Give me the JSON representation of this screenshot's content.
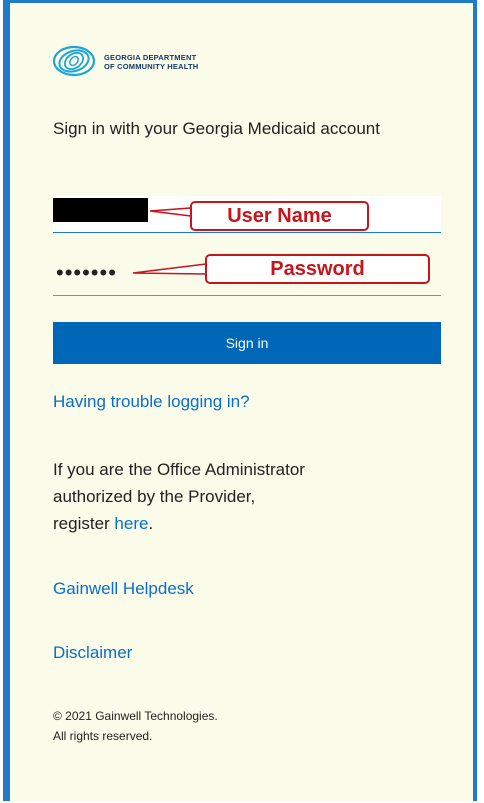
{
  "logo": {
    "line1": "Georgia Department",
    "line2": "of Community Health"
  },
  "heading": "Sign in with your Georgia Medicaid account",
  "username": {
    "value": "",
    "callout": "User Name"
  },
  "password": {
    "masked_value": "•••••••",
    "callout": "Password"
  },
  "sign_in_label": "Sign in",
  "trouble_link": "Having trouble logging in?",
  "admin_text": {
    "line1": "If you are the Office Administrator",
    "line2": "authorized by the Provider,",
    "prefix": "register ",
    "link": "here",
    "suffix": "."
  },
  "helpdesk_link": "Gainwell Helpdesk",
  "disclaimer_link": "Disclaimer",
  "copyright": {
    "line1": "© 2021 Gainwell Technologies.",
    "line2": "All rights reserved."
  },
  "colors": {
    "accent": "#0067b8",
    "link": "#0a6ec9",
    "callout": "#c8151c",
    "background": "#fbfbea"
  }
}
